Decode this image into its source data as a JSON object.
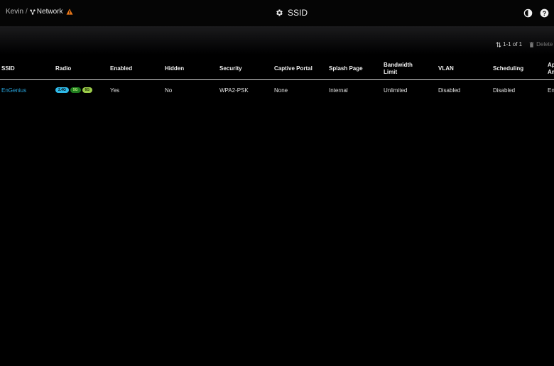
{
  "breadcrumb": {
    "org": "Kevin",
    "separator": "/",
    "network": "Network"
  },
  "page": {
    "title": "SSID"
  },
  "toolbar": {
    "count": "1-1 of 1",
    "delete_label": "Delete"
  },
  "table": {
    "columns": [
      "SSID",
      "Radio",
      "Enabled",
      "Hidden",
      "Security",
      "Captive Portal",
      "Splash Page",
      "Bandwidth Limit",
      "VLAN",
      "Scheduling",
      "Ap Am"
    ],
    "rows": [
      {
        "ssid": "EnGenius",
        "radios": [
          "2.4G",
          "5G",
          "6G"
        ],
        "enabled": "Yes",
        "hidden": "No",
        "security": "WPA2-PSK",
        "captive_portal": "None",
        "splash_page": "Internal",
        "bandwidth_limit": "Unlimited",
        "vlan": "Disabled",
        "scheduling": "Disabled",
        "last": "En"
      }
    ]
  },
  "colors": {
    "link": "#29a8e0",
    "warning": "#f07a1a",
    "badge_24": "#2fb9e8",
    "badge_5": "#1f7d1f",
    "badge_6": "#9ccc4a"
  }
}
